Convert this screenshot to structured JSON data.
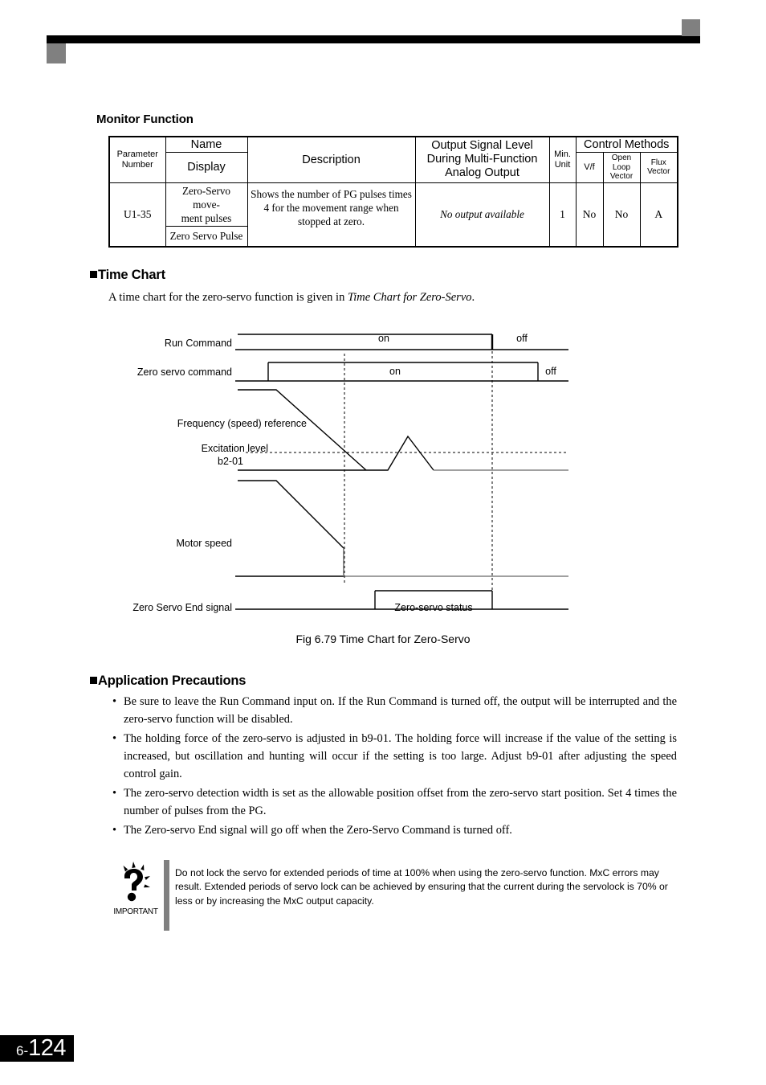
{
  "header": {
    "bar_color": "#000000",
    "square_color": "#808080"
  },
  "monitor_section": {
    "heading": "Monitor Function",
    "table": {
      "headers": {
        "parameter_number": "Parameter\nNumber",
        "name": "Name",
        "display": "Display",
        "description": "Description",
        "output_signal_level": "Output Signal Level\nDuring Multi-Function\nAnalog Output",
        "min_unit": "Min.\nUnit",
        "control_methods": "Control Methods",
        "vf": "V/f",
        "open_loop_vector": "Open\nLoop\nVector",
        "flux_vector": "Flux\nVector"
      },
      "rows": [
        {
          "parameter_number": "U1-35",
          "name": "Zero-Servo move-ment pulses",
          "display": "Zero Servo Pulse",
          "description": "Shows the number of PG pulses times 4 for the movement range when stopped at zero.",
          "output_signal_level": "No output available",
          "min_unit": "1",
          "vf": "No",
          "open_loop_vector": "No",
          "flux_vector": "A"
        }
      ]
    }
  },
  "time_chart_section": {
    "heading": "Time Chart",
    "intro_prefix": "A time chart for the zero-servo function is given in ",
    "intro_italic": "Time Chart for Zero-Servo",
    "intro_suffix": ".",
    "caption": "Fig 6.79  Time Chart for Zero-Servo",
    "labels": {
      "run_command": "Run Command",
      "zero_servo_command": "Zero servo command",
      "frequency_reference": "Frequency (speed) reference",
      "excitation_level": "Excitation level",
      "b2_01": "b2-01",
      "motor_speed": "Motor speed",
      "zero_servo_end_signal": "Zero Servo End signal"
    },
    "states": {
      "run_on": "on",
      "run_off": "off",
      "zs_on": "on",
      "zs_off": "off",
      "zero_servo_status": "Zero-servo status"
    }
  },
  "precautions_section": {
    "heading": "Application Precautions",
    "items": [
      "Be sure to leave the Run Command input on. If the Run Command is turned off, the output will be interrupted and the zero-servo function will be disabled.",
      "The holding force of the zero-servo is adjusted in b9-01. The holding force will increase if the value of the setting is increased, but oscillation and hunting will occur if the setting is too large. Adjust b9-01 after adjusting the speed control gain.",
      "The zero-servo detection width is set as the allowable position offset from the zero-servo start position. Set 4 times the number of pulses from the PG.",
      "The Zero-servo End signal will go off when the Zero-Servo Command is turned off."
    ],
    "bullet": "•"
  },
  "important_note": {
    "label": "IMPORTANT",
    "text": "Do not lock the servo for extended periods of time at 100% when using the zero-servo function. MxC errors may result. Extended periods of servo lock can be achieved by ensuring that the current during the servolock is 70% or less or by increasing the MxC output capacity.",
    "rule_color": "#808080"
  },
  "footer": {
    "chapter": "6-",
    "page": "124"
  }
}
